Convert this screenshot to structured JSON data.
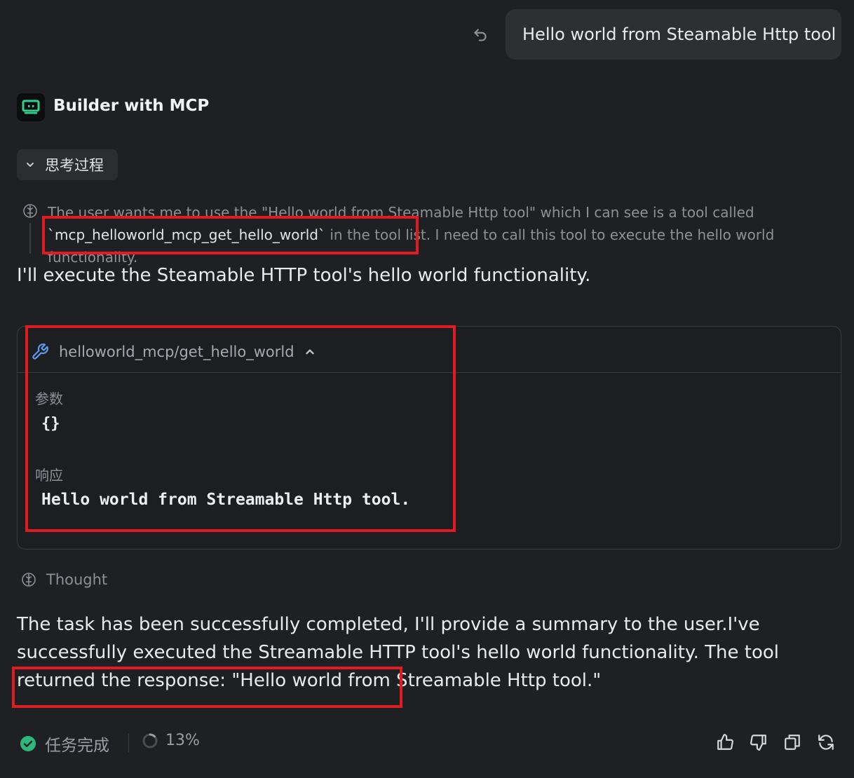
{
  "user_message": {
    "text": "Hello world from Steamable Http tool",
    "undo_icon": "undo-icon"
  },
  "agent": {
    "name": "Builder with MCP",
    "avatar_icon": "bot-icon",
    "avatar_color": "#2fd08c"
  },
  "thinking": {
    "toggle_label": "思考过程",
    "text_before": "The user wants me to use the \"Hello world from Steamable Http tool\" which I can see is a tool called ",
    "code": "`mcp_helloworld_mcp_get_hello_world`",
    "text_after": " in the tool list. I need to call this tool to execute the hello world functionality."
  },
  "reply_intro": "I'll execute the Steamable HTTP tool's hello world functionality.",
  "tool_call": {
    "name": "helloworld_mcp/get_hello_world",
    "icon": "wrench-icon",
    "icon_color": "#5b9cf0",
    "params_label": "参数",
    "params_value": "{}",
    "response_label": "响应",
    "response_value": "Hello world from Streamable Http tool."
  },
  "thought_label": "Thought",
  "final_reply": {
    "text": "The task has been successfully completed, I'll provide a summary to the user.I've successfully executed the Streamable HTTP tool's hello world functionality. The tool returned the response: ",
    "quote": "\"Hello world from Streamable Http tool.\""
  },
  "footer": {
    "status_label": "任务完成",
    "status_color": "#2fb67a",
    "progress": "13%",
    "actions": [
      "thumbs-up-icon",
      "thumbs-down-icon",
      "copy-icon",
      "regenerate-icon"
    ]
  },
  "highlight_color": "#e01b22"
}
